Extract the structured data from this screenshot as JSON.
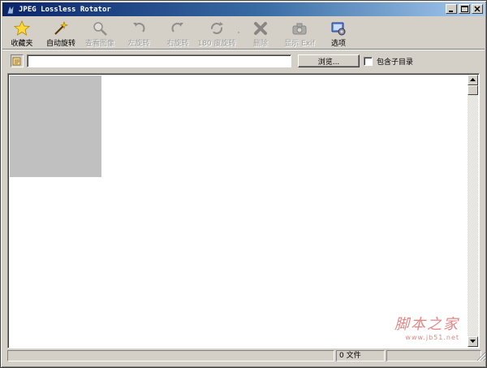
{
  "window": {
    "title": "JPEG Lossless Rotator",
    "controls": {
      "minimize": "minimize",
      "maximize": "maximize",
      "close": "close"
    }
  },
  "toolbar": {
    "items": [
      {
        "label": "收藏夹",
        "icon": "star-icon",
        "enabled": true
      },
      {
        "label": "自动旋转",
        "icon": "magic-wand-icon",
        "enabled": true
      },
      {
        "label": "查看图像",
        "icon": "magnifier-icon",
        "enabled": false
      },
      {
        "label": "左旋转",
        "icon": "rotate-left-icon",
        "enabled": false
      },
      {
        "label": "右旋转",
        "icon": "rotate-right-icon",
        "enabled": false
      },
      {
        "label": "180 度旋转",
        "icon": "rotate-180-icon",
        "enabled": false
      },
      {
        "label": "删除",
        "icon": "delete-x-icon",
        "enabled": false
      },
      {
        "label": "显示 Exif",
        "icon": "camera-icon",
        "enabled": false
      },
      {
        "label": "选项",
        "icon": "options-icon",
        "enabled": true
      }
    ]
  },
  "address": {
    "path_value": "",
    "browse_label": "浏览...",
    "subdir_label": "包含子目录",
    "subdir_checked": false
  },
  "status": {
    "panel1": "",
    "panel2": "0 文件",
    "panel3": ""
  },
  "watermark": {
    "main": "脚本之家",
    "url": "www.jb51.net"
  },
  "colors": {
    "titlebar_start": "#0a246a",
    "titlebar_end": "#a6caf0",
    "face": "#d4d0c8",
    "watermark": "#e07070"
  }
}
